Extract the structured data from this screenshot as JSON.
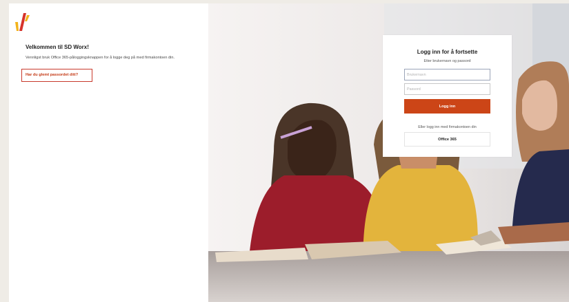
{
  "welcome": {
    "title": "Velkommen til SD Worx!",
    "text": "Vennligst bruk Office 365-påloggingsknappen for å logge deg på med firmakontoen din.",
    "forgot_link": "Har du glemt passordet ditt?"
  },
  "login": {
    "title": "Logg inn for å fortsette",
    "subtitle": "Etter brukernavn og passord",
    "username_placeholder": "Brukernavn",
    "password_placeholder": "Passord",
    "login_button": "Logg inn",
    "alt_text": "Eller logg inn med firmakontoen din",
    "office_button": "Office 365"
  },
  "colors": {
    "accent": "#cc4517",
    "logo_red": "#d6332a",
    "logo_yellow": "#f2b31b"
  },
  "icons": {
    "logo": "sd-worx-logo-icon"
  }
}
